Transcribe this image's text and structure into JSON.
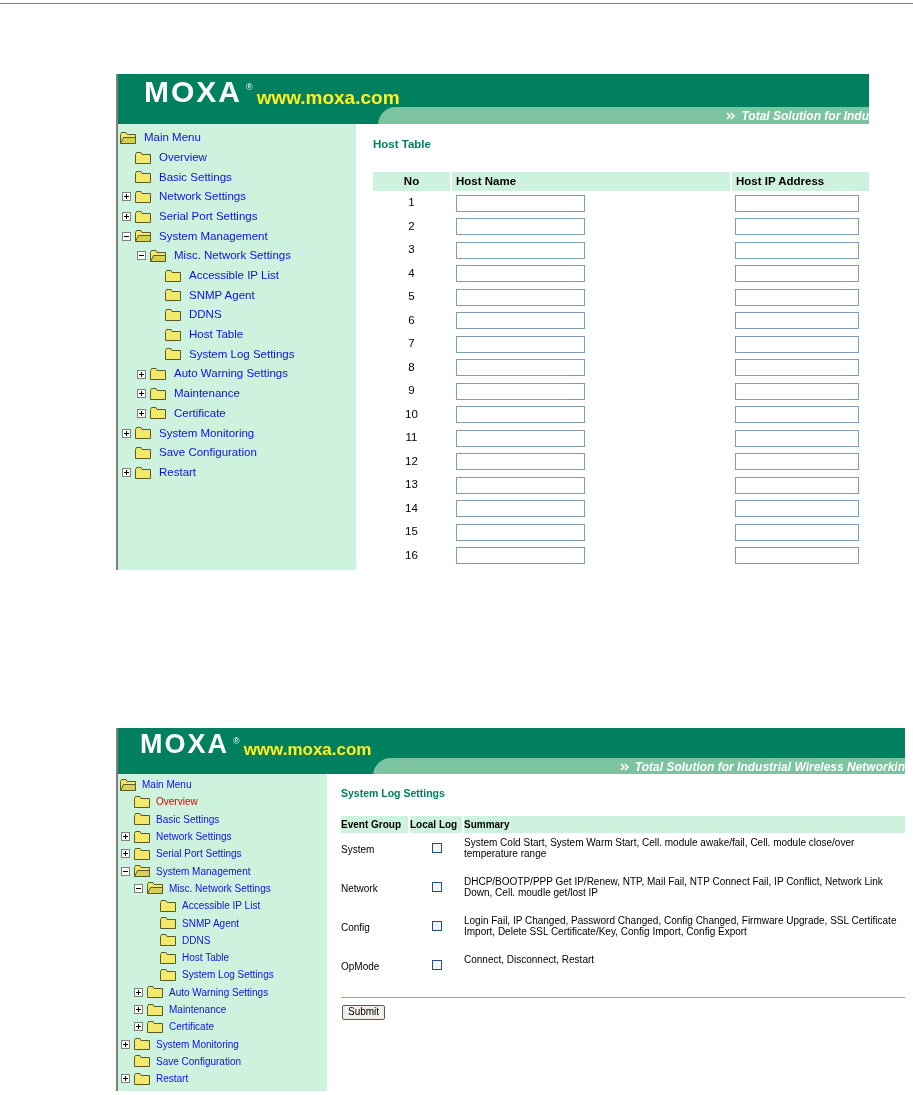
{
  "screens": [
    {
      "header": {
        "logo": "MOXA",
        "registered": "®",
        "url": "www.moxa.com",
        "tagline": "Total Solution for Indu"
      },
      "sidebar": {
        "root": "Main Menu",
        "items": [
          {
            "label": "Overview",
            "selected": false
          },
          {
            "label": "Basic Settings",
            "selected": false
          },
          {
            "label": "Network Settings",
            "selected": false,
            "expanded": false
          },
          {
            "label": "Serial Port Settings",
            "selected": false,
            "expanded": false
          },
          {
            "label": "System Management",
            "selected": false,
            "expanded": true,
            "children": [
              {
                "label": "Misc. Network Settings",
                "selected": false,
                "expanded": true,
                "children": [
                  {
                    "label": "Accessible IP List",
                    "selected": false
                  },
                  {
                    "label": "SNMP Agent",
                    "selected": false
                  },
                  {
                    "label": "DDNS",
                    "selected": false
                  },
                  {
                    "label": "Host Table",
                    "selected": false
                  },
                  {
                    "label": "System Log Settings",
                    "selected": false
                  }
                ]
              },
              {
                "label": "Auto Warning Settings",
                "selected": false,
                "expanded": false
              },
              {
                "label": "Maintenance",
                "selected": false,
                "expanded": false
              },
              {
                "label": "Certificate",
                "selected": false,
                "expanded": false
              }
            ]
          },
          {
            "label": "System Monitoring",
            "selected": false,
            "expanded": false
          },
          {
            "label": "Save Configuration",
            "selected": false
          },
          {
            "label": "Restart",
            "selected": false,
            "expanded": false
          }
        ]
      },
      "content": {
        "kind": "host_table",
        "title": "Host Table",
        "columns": [
          "No",
          "Host Name",
          "Host IP Address"
        ],
        "rows": [
          {
            "no": "1"
          },
          {
            "no": "2"
          },
          {
            "no": "3"
          },
          {
            "no": "4"
          },
          {
            "no": "5"
          },
          {
            "no": "6"
          },
          {
            "no": "7"
          },
          {
            "no": "8"
          },
          {
            "no": "9"
          },
          {
            "no": "10"
          },
          {
            "no": "11"
          },
          {
            "no": "12"
          },
          {
            "no": "13"
          },
          {
            "no": "14"
          },
          {
            "no": "15"
          },
          {
            "no": "16"
          }
        ]
      }
    },
    {
      "header": {
        "logo": "MOXA",
        "registered": "®",
        "url": "www.moxa.com",
        "tagline": "Total Solution for Industrial Wireless Networkin"
      },
      "sidebar": {
        "root": "Main Menu",
        "items": [
          {
            "label": "Overview",
            "selected": true
          },
          {
            "label": "Basic Settings",
            "selected": false
          },
          {
            "label": "Network Settings",
            "selected": false,
            "expanded": false
          },
          {
            "label": "Serial Port Settings",
            "selected": false,
            "expanded": false
          },
          {
            "label": "System Management",
            "selected": false,
            "expanded": true,
            "children": [
              {
                "label": "Misc. Network Settings",
                "selected": false,
                "expanded": true,
                "children": [
                  {
                    "label": "Accessible IP List",
                    "selected": false
                  },
                  {
                    "label": "SNMP Agent",
                    "selected": false
                  },
                  {
                    "label": "DDNS",
                    "selected": false
                  },
                  {
                    "label": "Host Table",
                    "selected": false
                  },
                  {
                    "label": "System Log Settings",
                    "selected": false
                  }
                ]
              },
              {
                "label": "Auto Warning Settings",
                "selected": false,
                "expanded": false
              },
              {
                "label": "Maintenance",
                "selected": false,
                "expanded": false
              },
              {
                "label": "Certificate",
                "selected": false,
                "expanded": false
              }
            ]
          },
          {
            "label": "System Monitoring",
            "selected": false,
            "expanded": false
          },
          {
            "label": "Save Configuration",
            "selected": false
          },
          {
            "label": "Restart",
            "selected": false,
            "expanded": false
          }
        ]
      },
      "content": {
        "kind": "syslog",
        "title": "System Log Settings",
        "columns": [
          "Event Group",
          "Local Log",
          "Summary"
        ],
        "rows": [
          {
            "group": "System",
            "checked": false,
            "summary": "System Cold Start, System Warm Start, Cell. module awake/fail, Cell. module close/over temperature range"
          },
          {
            "group": "Network",
            "checked": false,
            "summary": "DHCP/BOOTP/PPP Get IP/Renew, NTP, Mail Fail, NTP Connect Fail, IP Conflict, Network Link Down, Cell. moudle get/lost IP"
          },
          {
            "group": "Config",
            "checked": false,
            "summary": "Login Fail, IP Changed, Password Changed, Config Changed, Firmware Upgrade, SSL Certificate Import, Delete SSL Certificate/Key, Config Import, Config Export"
          },
          {
            "group": "OpMode",
            "checked": false,
            "summary": "Connect, Disconnect, Restart"
          }
        ],
        "button": "Submit"
      }
    }
  ]
}
